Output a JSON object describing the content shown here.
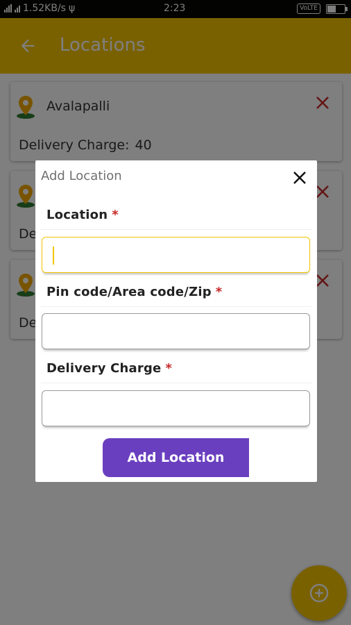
{
  "status_bar": {
    "network_speed": "1.52KB/s",
    "time": "2:23",
    "volte": "VoLTE",
    "battery_level": 0.45
  },
  "toolbar": {
    "title": "Locations",
    "back_icon": "arrow-left-icon"
  },
  "locations": [
    {
      "name": "Avalapalli",
      "charge_label": "Delivery Charge:",
      "charge_value": "40"
    },
    {
      "name": "",
      "charge_label": "De",
      "charge_value": ""
    },
    {
      "name": "",
      "charge_label": "De",
      "charge_value": ""
    }
  ],
  "dialog": {
    "title": "Add Location",
    "fields": [
      {
        "label": "Location",
        "required_mark": "*",
        "value": ""
      },
      {
        "label": "Pin code/Area code/Zip",
        "required_mark": "*",
        "value": ""
      },
      {
        "label": "Delivery Charge",
        "required_mark": "*",
        "value": ""
      }
    ],
    "submit_label": "Add Location"
  },
  "colors": {
    "toolbar": "#f2c300",
    "button": "#6a3fbf",
    "required": "#c62828",
    "delete": "#c62828",
    "pin": "#f2a900"
  }
}
